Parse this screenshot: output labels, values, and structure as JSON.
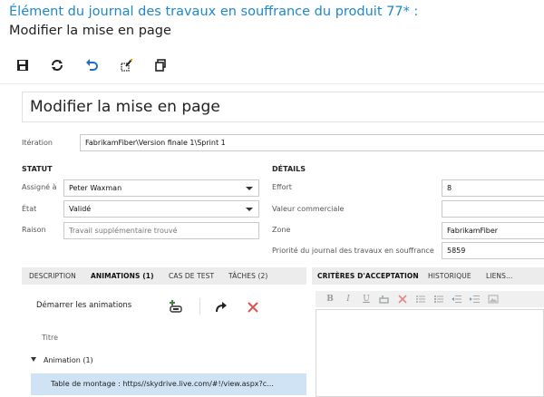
{
  "window": {
    "title_line1": "Élément du journal des travaux en souffrance du produit 77* :",
    "title_line2": "Modifier la mise en page"
  },
  "toolbar": {
    "icons": [
      "save-icon",
      "refresh-icon",
      "undo-icon",
      "copy-edit-icon",
      "new-window-icon"
    ]
  },
  "form": {
    "heading": "Modifier la mise en page",
    "iteration_label": "Itération",
    "iteration_value": "FabrikamFiber\\Version finale 1\\Sprint 1",
    "statut": {
      "header": "STATUT",
      "assigned_label": "Assigné à",
      "assigned_value": "Peter Waxman",
      "state_label": "État",
      "state_value": "Validé",
      "reason_label": "Raison",
      "reason_placeholder": "Travail supplémentaire trouvé"
    },
    "details": {
      "header": "DÉTAILS",
      "effort_label": "Effort",
      "effort_value": "8",
      "business_value_label": "Valeur commerciale",
      "business_value_value": "",
      "zone_label": "Zone",
      "zone_value": "FabrikamFiber",
      "priority_label": "Priorité du journal des travaux en souffrance",
      "priority_value": "5859"
    }
  },
  "left_tabs": {
    "description": "DESCRIPTION",
    "animations": "ANIMATIONS (1)",
    "test_cases": "CAS DE TEST",
    "tasks": "TÂCHES (2)"
  },
  "right_tabs": {
    "acceptance": "CRITÈRES D'ACCEPTATION",
    "history": "HISTORIQUE",
    "links": "LIENS..."
  },
  "animations_panel": {
    "start_label": "Démarrer les animations",
    "column_title": "Titre",
    "group_label": "Animation (1)",
    "row_text": "Table de montage : https//skydrive.live.com/#!/view.aspx?c..."
  },
  "editor": {
    "buttons": [
      "B",
      "I",
      "U"
    ]
  },
  "colors": {
    "title_blue": "#1e88c8",
    "selected_row": "#cfe3f5",
    "tab_strip": "#ececec",
    "delete_red": "#d9534f",
    "add_green": "#3a8a3a"
  }
}
